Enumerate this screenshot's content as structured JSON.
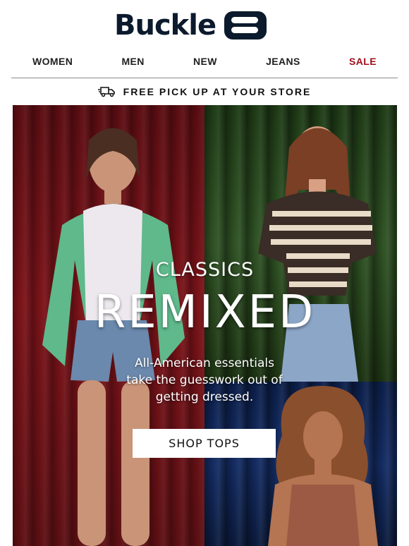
{
  "brand": {
    "name": "Buckle",
    "logo_color": "#0b1a2c"
  },
  "nav": {
    "items": [
      {
        "label": "WOMEN"
      },
      {
        "label": "MEN"
      },
      {
        "label": "NEW"
      },
      {
        "label": "JEANS"
      },
      {
        "label": "SALE"
      }
    ],
    "sale_color": "#a00f1b"
  },
  "pickup": {
    "icon": "truck-icon",
    "text": "FREE PICK UP AT YOUR STORE"
  },
  "hero": {
    "eyebrow": "CLASSICS",
    "title": "REMIXED",
    "subtitle_lines": [
      "All-American essentials",
      "take the guesswork out of",
      "getting dressed."
    ],
    "cta_label": "SHOP TOPS",
    "panel_colors": {
      "left": "#7a1319",
      "top_right": "#2f5224",
      "bottom_right": "#142c63"
    }
  }
}
